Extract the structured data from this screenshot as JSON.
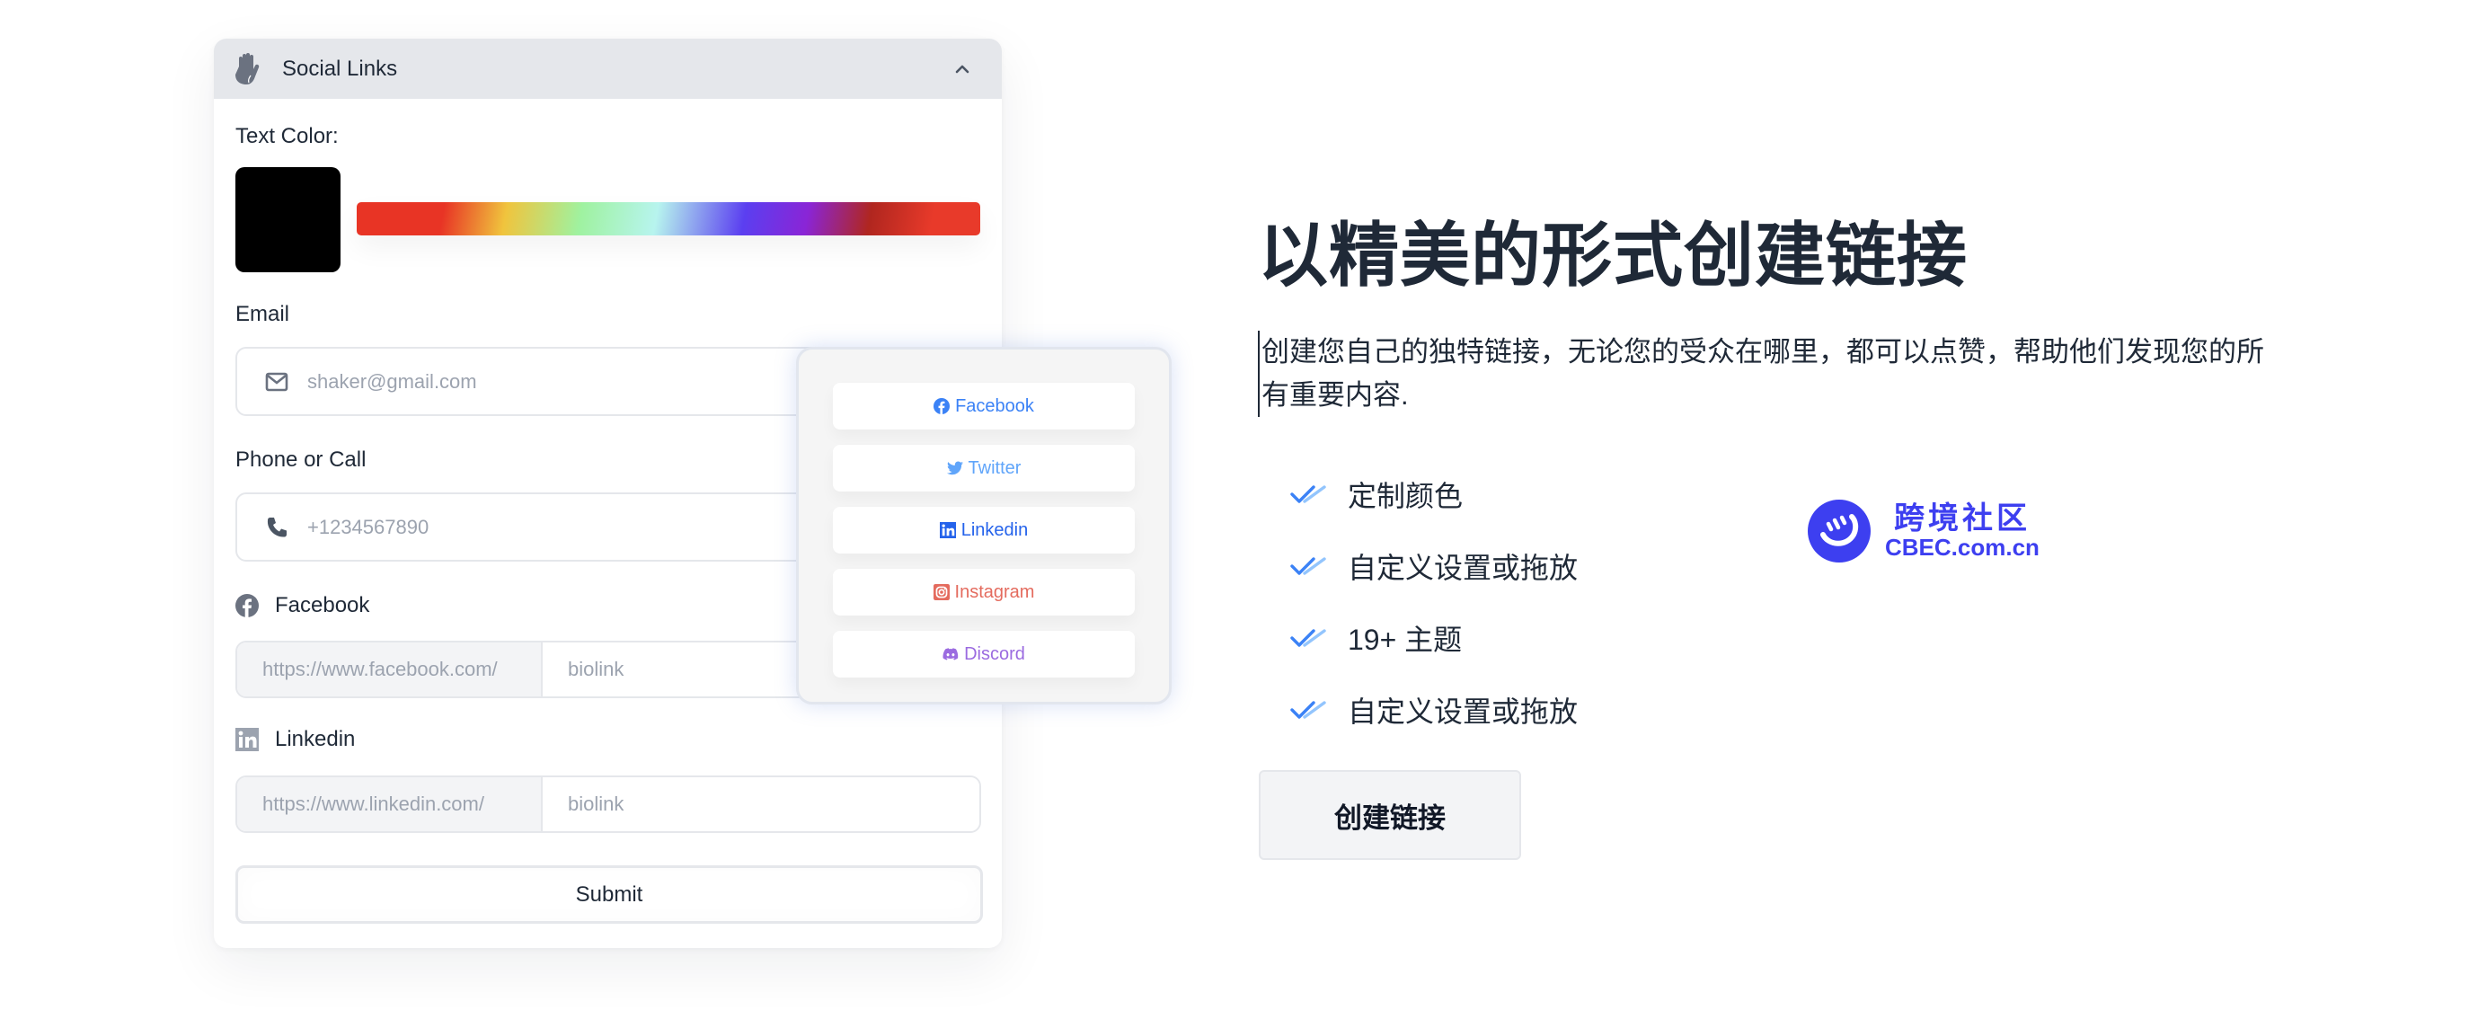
{
  "panel": {
    "title": "Social Links",
    "icons": {
      "header": "hand-icon",
      "collapse": "chevron-up-icon"
    },
    "text_color": {
      "label": "Text Color:",
      "selected_color": "#000000"
    },
    "email": {
      "label": "Email",
      "placeholder": "shaker@gmail.com",
      "icon": "mail-icon"
    },
    "phone": {
      "label": "Phone or Call",
      "placeholder": "+1234567890",
      "icon": "phone-icon"
    },
    "facebook": {
      "label": "Facebook",
      "prefix": "https://www.facebook.com/",
      "placeholder": "biolink",
      "icon": "facebook-icon"
    },
    "linkedin": {
      "label": "Linkedin",
      "prefix": "https://www.linkedin.com/",
      "placeholder": "biolink",
      "icon": "linkedin-icon"
    },
    "submit_label": "Submit"
  },
  "preview": {
    "buttons": [
      {
        "label": "Facebook",
        "icon": "facebook-icon",
        "color": "#3b82f6"
      },
      {
        "label": "Twitter",
        "icon": "twitter-icon",
        "color": "#60a5fa"
      },
      {
        "label": "Linkedin",
        "icon": "linkedin-icon",
        "color": "#2563eb"
      },
      {
        "label": "Instagram",
        "icon": "instagram-icon",
        "color": "#e46b5e"
      },
      {
        "label": "Discord",
        "icon": "discord-icon",
        "color": "#9b6be0"
      }
    ]
  },
  "hero": {
    "title": "以精美的形式创建链接",
    "description": "创建您自己的独特链接，无论您的受众在哪里，都可以点赞，帮助他们发现您的所有重要内容.",
    "features": [
      "定制颜色",
      "自定义设置或拖放",
      "19+ 主题",
      "自定义设置或拖放"
    ],
    "cta_label": "创建链接"
  },
  "watermark": {
    "name_cn": "跨境社区",
    "name_en": "CBEC.com.cn",
    "color": "#3d3ff0"
  }
}
